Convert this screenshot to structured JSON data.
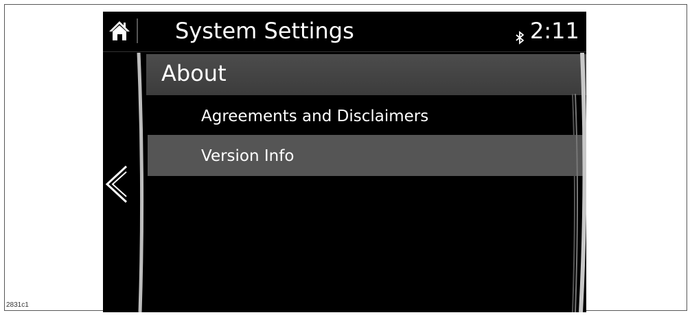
{
  "figure_id": "2831c1",
  "header": {
    "title": "System Settings",
    "time": "2:11",
    "home_icon": "home-icon",
    "bluetooth_icon": "bluetooth-icon"
  },
  "section": {
    "title": "About"
  },
  "menu": {
    "items": [
      {
        "label": "Agreements and Disclaimers",
        "selected": false
      },
      {
        "label": "Version Info",
        "selected": true
      }
    ]
  },
  "nav": {
    "back_icon": "back-arrow-icon"
  },
  "colors": {
    "screen_bg": "#000000",
    "section_bg": "#444444",
    "selected_bg": "#555555",
    "text": "#ffffff"
  }
}
